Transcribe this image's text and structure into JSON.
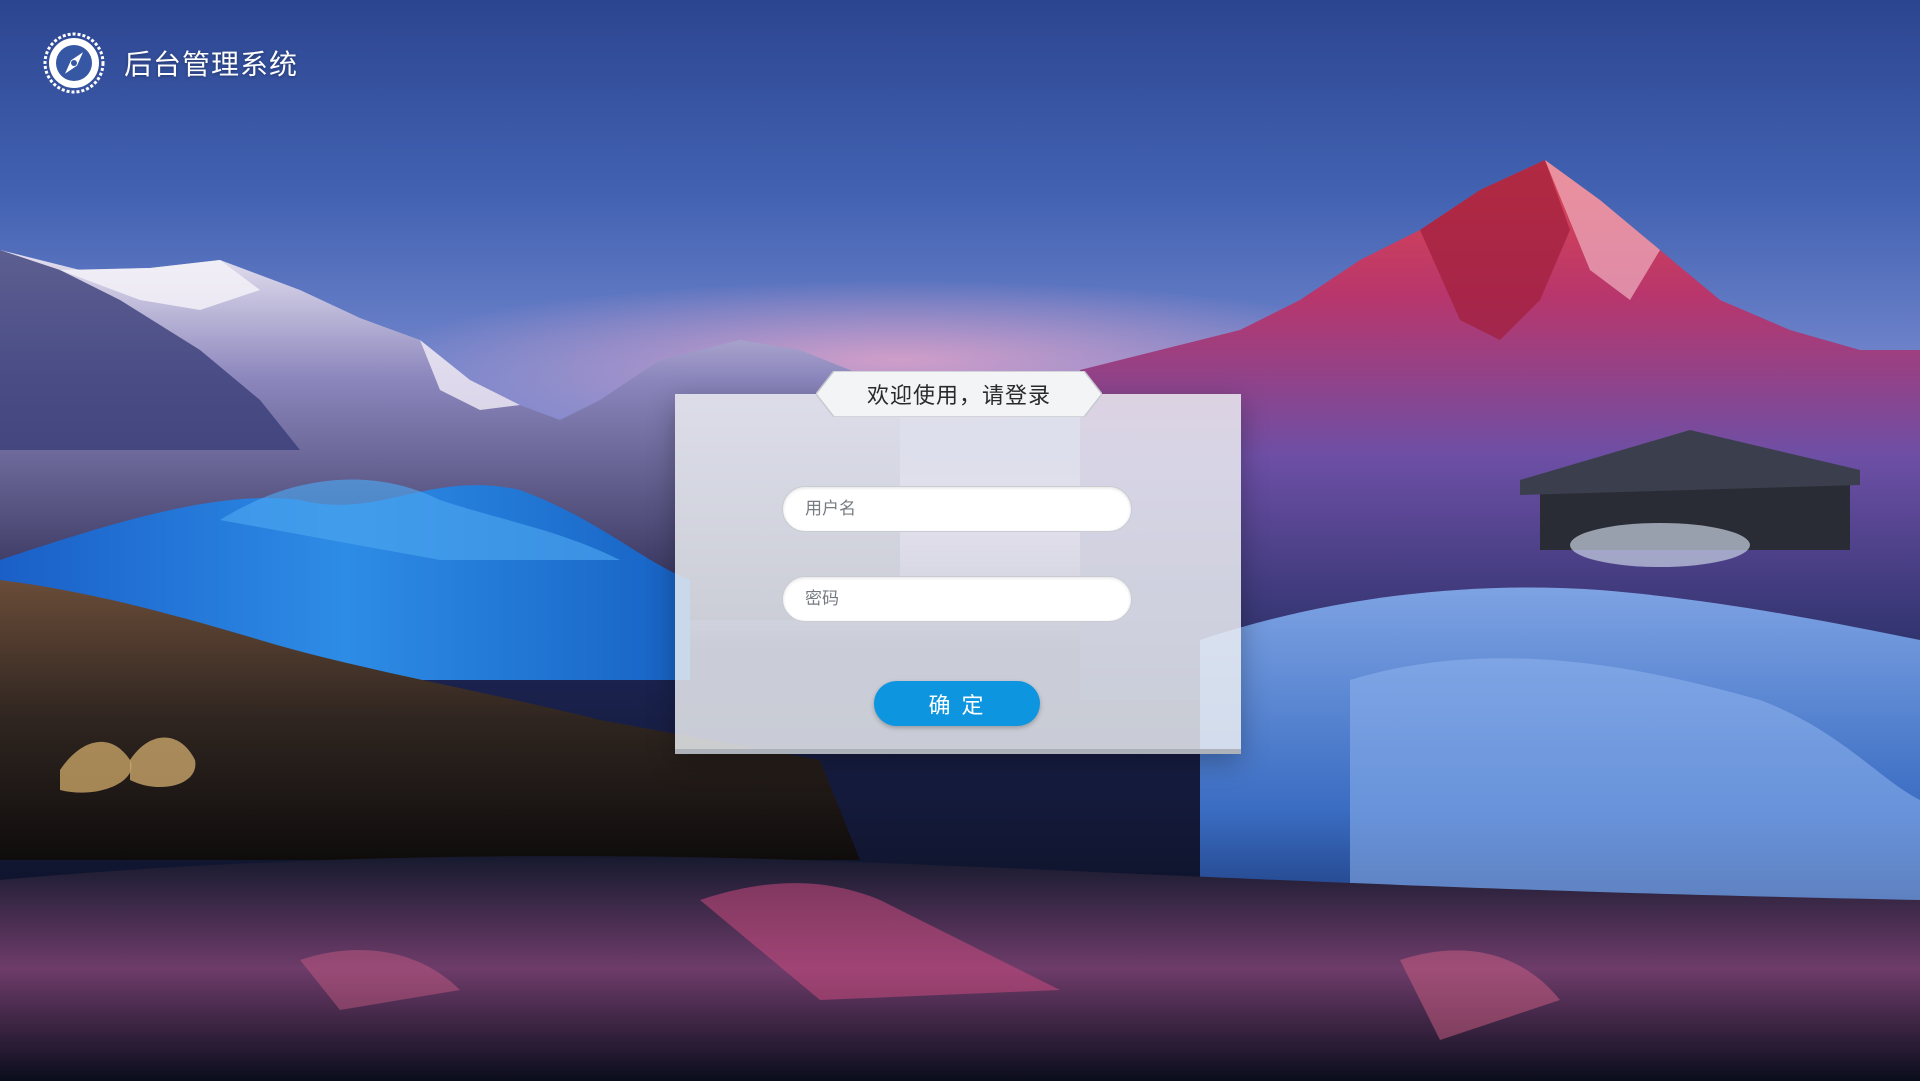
{
  "app": {
    "title": "后台管理系统"
  },
  "login": {
    "heading": "欢迎使用，请登录",
    "username_placeholder": "用户名",
    "password_placeholder": "密码",
    "submit_label": "确    定"
  },
  "icons": {
    "logo": "compass-emblem-icon"
  },
  "colors": {
    "accent": "#0e95df",
    "panel": "#eceef2"
  }
}
